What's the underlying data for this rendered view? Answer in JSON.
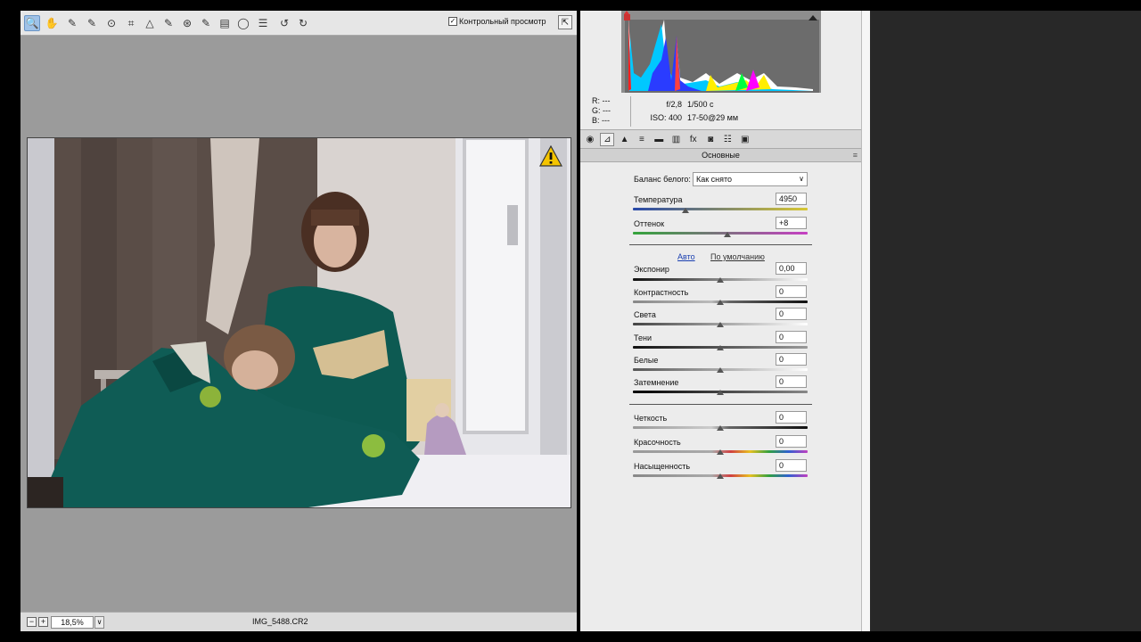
{
  "toolbar": {
    "tools": [
      {
        "icon": "zoom-icon",
        "glyph": "🔍"
      },
      {
        "icon": "hand-icon",
        "glyph": "✋"
      },
      {
        "icon": "white-balance-icon",
        "glyph": "✎"
      },
      {
        "icon": "color-sampler-icon",
        "glyph": "✎"
      },
      {
        "icon": "targeted-adjust-icon",
        "glyph": "⊙"
      },
      {
        "icon": "crop-icon",
        "glyph": "⌗"
      },
      {
        "icon": "straighten-icon",
        "glyph": "△"
      },
      {
        "icon": "spot-removal-icon",
        "glyph": "✎"
      },
      {
        "icon": "red-eye-icon",
        "glyph": "⊛"
      },
      {
        "icon": "adjust-brush-icon",
        "glyph": "✎"
      },
      {
        "icon": "graduated-filter-icon",
        "glyph": "▤"
      },
      {
        "icon": "radial-filter-icon",
        "glyph": "◯"
      },
      {
        "icon": "preferences-icon",
        "glyph": "☰"
      },
      {
        "icon": "rotate-left-icon",
        "glyph": "↺"
      },
      {
        "icon": "rotate-right-icon",
        "glyph": "↻"
      }
    ],
    "preview_label": "Контрольный просмотр",
    "preview_checked": true
  },
  "status": {
    "zoom_minus": "−",
    "zoom_plus": "+",
    "zoom": "18,5%",
    "filename": "IMG_5488.CR2"
  },
  "info": {
    "r_label": "R:",
    "r_value": "---",
    "g_label": "G:",
    "g_value": "---",
    "b_label": "B:",
    "b_value": "---",
    "aperture": "f/2,8",
    "shutter": "1/500 с",
    "iso": "ISO: 400",
    "lens": "17-50@29 мм"
  },
  "panel_tabs": [
    "basic-icon",
    "tone-curve-icon",
    "detail-icon",
    "hsl-icon",
    "split-toning-icon",
    "lens-icon",
    "fx-icon",
    "camera-calibration-icon",
    "presets-icon",
    "snapshots-icon"
  ],
  "basic": {
    "section_title": "Основные",
    "wb_label": "Баланс белого:",
    "wb_value": "Как снято",
    "temperature_label": "Температура",
    "temperature_value": "4950",
    "tint_label": "Оттенок",
    "tint_value": "+8",
    "auto_link": "Авто",
    "default_link": "По умолчанию",
    "exposure_label": "Экспонир",
    "exposure_value": "0,00",
    "contrast_label": "Контрастность",
    "contrast_value": "0",
    "highlights_label": "Света",
    "highlights_value": "0",
    "shadows_label": "Тени",
    "shadows_value": "0",
    "whites_label": "Белые",
    "whites_value": "0",
    "blacks_label": "Затемнение",
    "blacks_value": "0",
    "clarity_label": "Четкость",
    "clarity_value": "0",
    "vibrance_label": "Красочность",
    "vibrance_value": "0",
    "saturation_label": "Насыщенность",
    "saturation_value": "0"
  },
  "colors": {
    "accent": "#9fc2e8",
    "warning": "#f5c400",
    "panel_bg": "#ececec",
    "preview_bg": "#9b9b9b"
  }
}
